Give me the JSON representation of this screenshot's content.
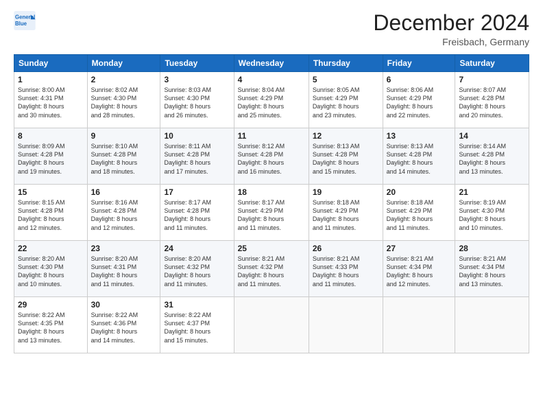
{
  "header": {
    "logo_line1": "General",
    "logo_line2": "Blue",
    "month": "December 2024",
    "location": "Freisbach, Germany"
  },
  "weekdays": [
    "Sunday",
    "Monday",
    "Tuesday",
    "Wednesday",
    "Thursday",
    "Friday",
    "Saturday"
  ],
  "weeks": [
    [
      {
        "day": "1",
        "lines": [
          "Sunrise: 8:00 AM",
          "Sunset: 4:31 PM",
          "Daylight: 8 hours",
          "and 30 minutes."
        ]
      },
      {
        "day": "2",
        "lines": [
          "Sunrise: 8:02 AM",
          "Sunset: 4:30 PM",
          "Daylight: 8 hours",
          "and 28 minutes."
        ]
      },
      {
        "day": "3",
        "lines": [
          "Sunrise: 8:03 AM",
          "Sunset: 4:30 PM",
          "Daylight: 8 hours",
          "and 26 minutes."
        ]
      },
      {
        "day": "4",
        "lines": [
          "Sunrise: 8:04 AM",
          "Sunset: 4:29 PM",
          "Daylight: 8 hours",
          "and 25 minutes."
        ]
      },
      {
        "day": "5",
        "lines": [
          "Sunrise: 8:05 AM",
          "Sunset: 4:29 PM",
          "Daylight: 8 hours",
          "and 23 minutes."
        ]
      },
      {
        "day": "6",
        "lines": [
          "Sunrise: 8:06 AM",
          "Sunset: 4:29 PM",
          "Daylight: 8 hours",
          "and 22 minutes."
        ]
      },
      {
        "day": "7",
        "lines": [
          "Sunrise: 8:07 AM",
          "Sunset: 4:28 PM",
          "Daylight: 8 hours",
          "and 20 minutes."
        ]
      }
    ],
    [
      {
        "day": "8",
        "lines": [
          "Sunrise: 8:09 AM",
          "Sunset: 4:28 PM",
          "Daylight: 8 hours",
          "and 19 minutes."
        ]
      },
      {
        "day": "9",
        "lines": [
          "Sunrise: 8:10 AM",
          "Sunset: 4:28 PM",
          "Daylight: 8 hours",
          "and 18 minutes."
        ]
      },
      {
        "day": "10",
        "lines": [
          "Sunrise: 8:11 AM",
          "Sunset: 4:28 PM",
          "Daylight: 8 hours",
          "and 17 minutes."
        ]
      },
      {
        "day": "11",
        "lines": [
          "Sunrise: 8:12 AM",
          "Sunset: 4:28 PM",
          "Daylight: 8 hours",
          "and 16 minutes."
        ]
      },
      {
        "day": "12",
        "lines": [
          "Sunrise: 8:13 AM",
          "Sunset: 4:28 PM",
          "Daylight: 8 hours",
          "and 15 minutes."
        ]
      },
      {
        "day": "13",
        "lines": [
          "Sunrise: 8:13 AM",
          "Sunset: 4:28 PM",
          "Daylight: 8 hours",
          "and 14 minutes."
        ]
      },
      {
        "day": "14",
        "lines": [
          "Sunrise: 8:14 AM",
          "Sunset: 4:28 PM",
          "Daylight: 8 hours",
          "and 13 minutes."
        ]
      }
    ],
    [
      {
        "day": "15",
        "lines": [
          "Sunrise: 8:15 AM",
          "Sunset: 4:28 PM",
          "Daylight: 8 hours",
          "and 12 minutes."
        ]
      },
      {
        "day": "16",
        "lines": [
          "Sunrise: 8:16 AM",
          "Sunset: 4:28 PM",
          "Daylight: 8 hours",
          "and 12 minutes."
        ]
      },
      {
        "day": "17",
        "lines": [
          "Sunrise: 8:17 AM",
          "Sunset: 4:28 PM",
          "Daylight: 8 hours",
          "and 11 minutes."
        ]
      },
      {
        "day": "18",
        "lines": [
          "Sunrise: 8:17 AM",
          "Sunset: 4:29 PM",
          "Daylight: 8 hours",
          "and 11 minutes."
        ]
      },
      {
        "day": "19",
        "lines": [
          "Sunrise: 8:18 AM",
          "Sunset: 4:29 PM",
          "Daylight: 8 hours",
          "and 11 minutes."
        ]
      },
      {
        "day": "20",
        "lines": [
          "Sunrise: 8:18 AM",
          "Sunset: 4:29 PM",
          "Daylight: 8 hours",
          "and 11 minutes."
        ]
      },
      {
        "day": "21",
        "lines": [
          "Sunrise: 8:19 AM",
          "Sunset: 4:30 PM",
          "Daylight: 8 hours",
          "and 10 minutes."
        ]
      }
    ],
    [
      {
        "day": "22",
        "lines": [
          "Sunrise: 8:20 AM",
          "Sunset: 4:30 PM",
          "Daylight: 8 hours",
          "and 10 minutes."
        ]
      },
      {
        "day": "23",
        "lines": [
          "Sunrise: 8:20 AM",
          "Sunset: 4:31 PM",
          "Daylight: 8 hours",
          "and 11 minutes."
        ]
      },
      {
        "day": "24",
        "lines": [
          "Sunrise: 8:20 AM",
          "Sunset: 4:32 PM",
          "Daylight: 8 hours",
          "and 11 minutes."
        ]
      },
      {
        "day": "25",
        "lines": [
          "Sunrise: 8:21 AM",
          "Sunset: 4:32 PM",
          "Daylight: 8 hours",
          "and 11 minutes."
        ]
      },
      {
        "day": "26",
        "lines": [
          "Sunrise: 8:21 AM",
          "Sunset: 4:33 PM",
          "Daylight: 8 hours",
          "and 11 minutes."
        ]
      },
      {
        "day": "27",
        "lines": [
          "Sunrise: 8:21 AM",
          "Sunset: 4:34 PM",
          "Daylight: 8 hours",
          "and 12 minutes."
        ]
      },
      {
        "day": "28",
        "lines": [
          "Sunrise: 8:21 AM",
          "Sunset: 4:34 PM",
          "Daylight: 8 hours",
          "and 13 minutes."
        ]
      }
    ],
    [
      {
        "day": "29",
        "lines": [
          "Sunrise: 8:22 AM",
          "Sunset: 4:35 PM",
          "Daylight: 8 hours",
          "and 13 minutes."
        ]
      },
      {
        "day": "30",
        "lines": [
          "Sunrise: 8:22 AM",
          "Sunset: 4:36 PM",
          "Daylight: 8 hours",
          "and 14 minutes."
        ]
      },
      {
        "day": "31",
        "lines": [
          "Sunrise: 8:22 AM",
          "Sunset: 4:37 PM",
          "Daylight: 8 hours",
          "and 15 minutes."
        ]
      },
      null,
      null,
      null,
      null
    ]
  ]
}
